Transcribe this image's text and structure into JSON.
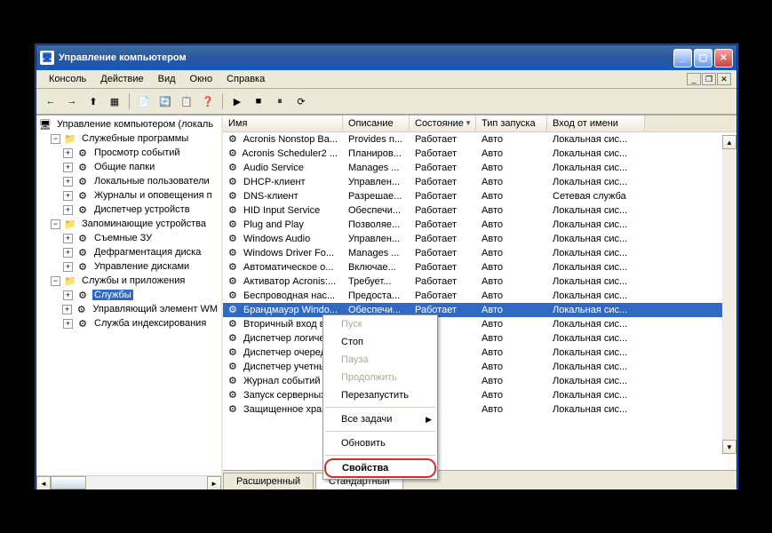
{
  "titlebar": {
    "title": "Управление компьютером"
  },
  "menubar": {
    "items": [
      "Консоль",
      "Действие",
      "Вид",
      "Окно",
      "Справка"
    ]
  },
  "tree": {
    "root": "Управление компьютером (локаль",
    "groups": [
      {
        "label": "Служебные программы",
        "children": [
          "Просмотр событий",
          "Общие папки",
          "Локальные пользователи",
          "Журналы и оповещения п",
          "Диспетчер устройств"
        ]
      },
      {
        "label": "Запоминающие устройства",
        "children": [
          "Съемные ЗУ",
          "Дефрагментация диска",
          "Управление дисками"
        ]
      },
      {
        "label": "Службы и приложения",
        "children": [
          "Службы",
          "Управляющий элемент WM",
          "Служба индексирования"
        ],
        "selected_child": 0
      }
    ]
  },
  "columns": {
    "name": "Имя",
    "desc": "Описание",
    "state": "Состояние",
    "start": "Тип запуска",
    "logon": "Вход от имени"
  },
  "services": [
    {
      "name": "Acronis Nonstop Ba...",
      "desc": "Provides n...",
      "state": "Работает",
      "start": "Авто",
      "logon": "Локальная сис..."
    },
    {
      "name": "Acronis Scheduler2 ...",
      "desc": "Планиров...",
      "state": "Работает",
      "start": "Авто",
      "logon": "Локальная сис..."
    },
    {
      "name": "Audio Service",
      "desc": "Manages ...",
      "state": "Работает",
      "start": "Авто",
      "logon": "Локальная сис..."
    },
    {
      "name": "DHCP-клиент",
      "desc": "Управлен...",
      "state": "Работает",
      "start": "Авто",
      "logon": "Локальная сис..."
    },
    {
      "name": "DNS-клиент",
      "desc": "Разрешае...",
      "state": "Работает",
      "start": "Авто",
      "logon": "Сетевая служба"
    },
    {
      "name": "HID Input Service",
      "desc": "Обеспечи...",
      "state": "Работает",
      "start": "Авто",
      "logon": "Локальная сис..."
    },
    {
      "name": "Plug and Play",
      "desc": "Позволяе...",
      "state": "Работает",
      "start": "Авто",
      "logon": "Локальная сис..."
    },
    {
      "name": "Windows Audio",
      "desc": "Управлен...",
      "state": "Работает",
      "start": "Авто",
      "logon": "Локальная сис..."
    },
    {
      "name": "Windows Driver Fo...",
      "desc": "Manages ...",
      "state": "Работает",
      "start": "Авто",
      "logon": "Локальная сис..."
    },
    {
      "name": "Автоматическое о...",
      "desc": "Включае...",
      "state": "Работает",
      "start": "Авто",
      "logon": "Локальная сис..."
    },
    {
      "name": "Активатор Acronis:...",
      "desc": "Требует...",
      "state": "Работает",
      "start": "Авто",
      "logon": "Локальная сис..."
    },
    {
      "name": "Беспроводная нас...",
      "desc": "Предоста...",
      "state": "Работает",
      "start": "Авто",
      "logon": "Локальная сис..."
    },
    {
      "name": "Брандмауэр Windo...",
      "desc": "Обеспечи...",
      "state": "Работает",
      "start": "Авто",
      "logon": "Локальная сис...",
      "selected": true
    },
    {
      "name": "Вторичный вход в ",
      "desc": "",
      "state": "",
      "start": "Авто",
      "logon": "Локальная сис..."
    },
    {
      "name": "Диспетчер логиче ",
      "desc": "",
      "state": "",
      "start": "Авто",
      "logon": "Локальная сис..."
    },
    {
      "name": "Диспетчер очеред ",
      "desc": "",
      "state": "",
      "start": "Авто",
      "logon": "Локальная сис..."
    },
    {
      "name": "Диспетчер учетны ",
      "desc": "",
      "state": "",
      "start": "Авто",
      "logon": "Локальная сис..."
    },
    {
      "name": "Журнал событий",
      "desc": "",
      "state": "",
      "start": "Авто",
      "logon": "Локальная сис..."
    },
    {
      "name": "Запуск серверных ",
      "desc": "",
      "state": "",
      "start": "Авто",
      "logon": "Локальная сис..."
    },
    {
      "name": "Защищенное хран ",
      "desc": "",
      "state": "",
      "start": "Авто",
      "logon": "Локальная сис..."
    }
  ],
  "tabs": {
    "extended": "Расширенный",
    "standard": "Стандартный"
  },
  "context_menu": {
    "start": "Пуск",
    "stop": "Стоп",
    "pause": "Пауза",
    "resume": "Продолжить",
    "restart": "Перезапустить",
    "all_tasks": "Все задачи",
    "refresh": "Обновить",
    "properties": "Свойства"
  }
}
